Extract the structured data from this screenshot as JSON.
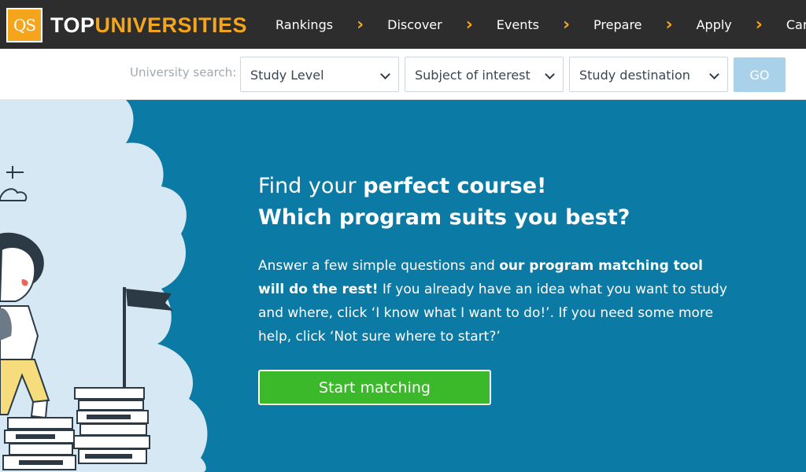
{
  "brand": {
    "logo_text": "QS",
    "name_part1": "TOP",
    "name_part2": "UNIVERSITIES",
    "accent": "#f4a51c"
  },
  "nav": {
    "items": [
      "Rankings",
      "Discover",
      "Events",
      "Prepare",
      "Apply",
      "Careers"
    ]
  },
  "search": {
    "label": "University search:",
    "study_level": "Study Level",
    "subject": "Subject of interest",
    "destination": "Study destination",
    "go_label": "GO"
  },
  "hero": {
    "line1_normal": "Find your ",
    "line1_bold": "perfect course!",
    "line2": "Which program suits you best?",
    "p1_normal": "Answer a few simple questions and ",
    "p1_bold": "our program matching tool will do the rest!",
    "p2": " If you already have an idea what you want to study and where, click ‘I know what I want to do!’. If you need some more help, click ‘Not sure where to start?’",
    "cta_label": "Start matching",
    "background": "#0b7aa5",
    "cta_color": "#3cb82b"
  }
}
